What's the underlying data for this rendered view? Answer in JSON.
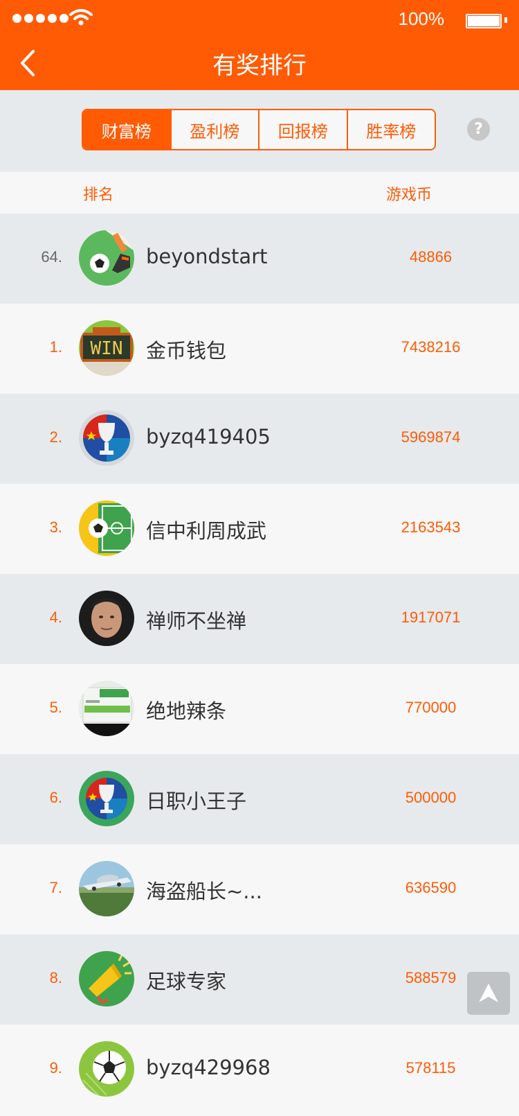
{
  "status_bar": {
    "battery_text": "100%",
    "battery_level": 1.0
  },
  "header": {
    "title": "有奖排行"
  },
  "tabs": [
    {
      "label": "财富榜",
      "active": true
    },
    {
      "label": "盈利榜",
      "active": false
    },
    {
      "label": "回报榜",
      "active": false
    },
    {
      "label": "胜率榜",
      "active": false
    }
  ],
  "help_label": "?",
  "columns": {
    "rank": "排名",
    "coins": "游戏币"
  },
  "my_entry": {
    "rank": "64.",
    "name": "beyondstart",
    "coins": "48866",
    "avatar": "soccer-boot-avatar"
  },
  "rows": [
    {
      "rank": "1.",
      "name": "金币钱包",
      "coins": "7438216",
      "avatar": "win-scoreboard-avatar"
    },
    {
      "rank": "2.",
      "name": "byzq419405",
      "coins": "5969874",
      "avatar": "euro-trophy-avatar"
    },
    {
      "rank": "3.",
      "name": "信中利周成武",
      "coins": "2163543",
      "avatar": "soccer-field-avatar"
    },
    {
      "rank": "4.",
      "name": "禅师不坐禅",
      "coins": "1917071",
      "avatar": "man-photo-avatar"
    },
    {
      "rank": "5.",
      "name": "绝地辣条",
      "coins": "770000",
      "avatar": "product-box-avatar"
    },
    {
      "rank": "6.",
      "name": "日职小王子",
      "coins": "500000",
      "avatar": "euro-trophy-avatar"
    },
    {
      "rank": "7.",
      "name": "海盗船长~...",
      "coins": "636590",
      "avatar": "flying-car-avatar"
    },
    {
      "rank": "8.",
      "name": "足球专家",
      "coins": "588579",
      "avatar": "megaphone-avatar"
    },
    {
      "rank": "9.",
      "name": "byzq429968",
      "coins": "578115",
      "avatar": "soccer-ball-avatar"
    }
  ],
  "colors": {
    "brand": "#ff5b05",
    "row_shade": "#e7eaec",
    "row_light": "#f7f7f7"
  }
}
